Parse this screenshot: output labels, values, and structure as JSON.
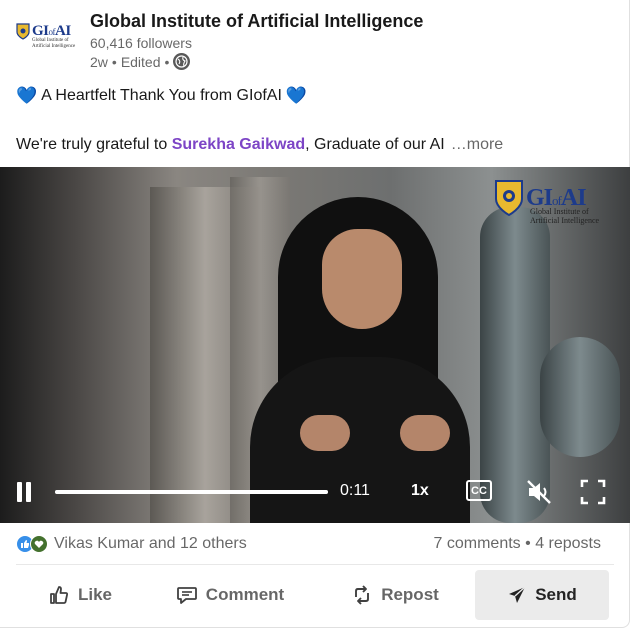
{
  "post": {
    "author": {
      "name": "Global Institute of Artificial Intelligence",
      "followers": "60,416 followers",
      "age": "2w",
      "edited": "Edited",
      "logo": {
        "text_main": "GI",
        "text_of": "of",
        "text_end": "AI",
        "subtitle": "Global Institute of Artificial Intelligence"
      }
    },
    "headline": "A Heartfelt Thank You from GIofAI",
    "heart_emoji": "💙",
    "body_prefix": "We're truly grateful to ",
    "mention": "Surekha Gaikwad",
    "body_suffix": ", Graduate of our AI",
    "more_label": "…more"
  },
  "video": {
    "watermark": {
      "text_main": "GI",
      "text_of": "of",
      "text_end": "AI",
      "subtitle_line1": "Global Institute of",
      "subtitle_line2": "Artificial Intelligence"
    },
    "time": "0:11",
    "speed": "1x",
    "cc_label": "CC",
    "progress": 1.0,
    "muted": true
  },
  "social": {
    "reactors": "Vikas Kumar and 12 others",
    "comments": "7 comments",
    "separator": "•",
    "reposts": "4 reposts"
  },
  "actions": {
    "like": "Like",
    "comment": "Comment",
    "repost": "Repost",
    "send": "Send"
  },
  "colors": {
    "mention": "#7d45c6",
    "brand": "#1d3b8b",
    "like_reaction": "#378fe9",
    "support_reaction": "#44712e"
  }
}
